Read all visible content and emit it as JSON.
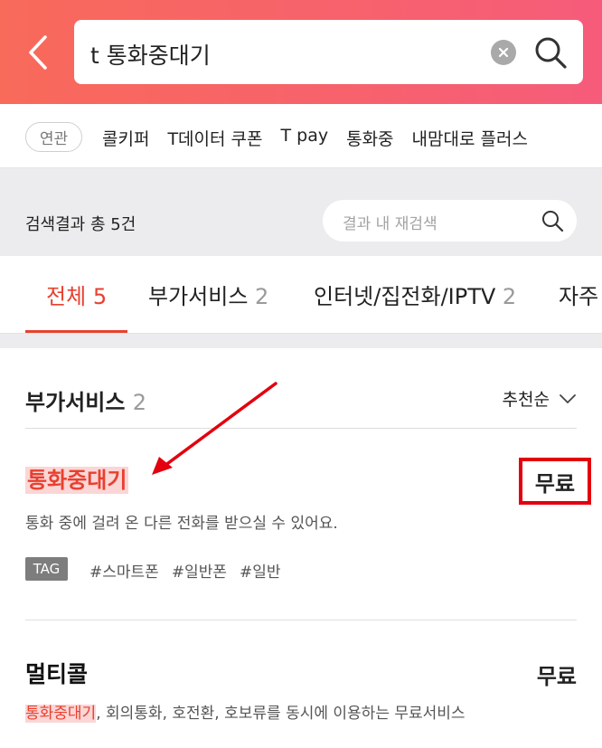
{
  "header": {
    "search_value": "t 통화중대기",
    "back_icon": "chevron-left-icon",
    "clear_icon": "clear-circle-icon",
    "search_icon": "search-icon",
    "gradient_start": "#f86a5a",
    "gradient_end": "#f65c7a"
  },
  "related": {
    "badge": "연관",
    "keywords": [
      "콜키퍼",
      "T데이터 쿠폰",
      "T pay",
      "통화중",
      "내맘대로 플러스"
    ]
  },
  "result_bar": {
    "count_text": "검색결과 총 5건",
    "inner_search_placeholder": "결과 내 재검색"
  },
  "tabs": [
    {
      "label": "전체",
      "count": "5",
      "active": true
    },
    {
      "label": "부가서비스",
      "count": "2",
      "active": false
    },
    {
      "label": "인터넷/집전화/IPTV",
      "count": "2",
      "active": false
    },
    {
      "label": "자주",
      "count": "",
      "active": false
    }
  ],
  "section": {
    "title": "부가서비스",
    "count": "2",
    "sort_label": "추천순"
  },
  "items": [
    {
      "name": "통화중대기",
      "price": "무료",
      "desc": "통화 중에 걸려 온 다른 전화를 받으실 수 있어요.",
      "tag_label": "TAG",
      "tags": [
        "#스마트폰",
        "#일반폰",
        "#일반"
      ]
    },
    {
      "name": "멀티콜",
      "price": "무료",
      "desc_highlight": "통화중대기",
      "desc_rest": ", 회의통화, 호전환, 호보류를 동시에 이용하는 무료서비스"
    }
  ],
  "colors": {
    "accent": "#e8402f",
    "annotation_red": "#e3000f",
    "highlight_bg": "#fbd6d6"
  }
}
